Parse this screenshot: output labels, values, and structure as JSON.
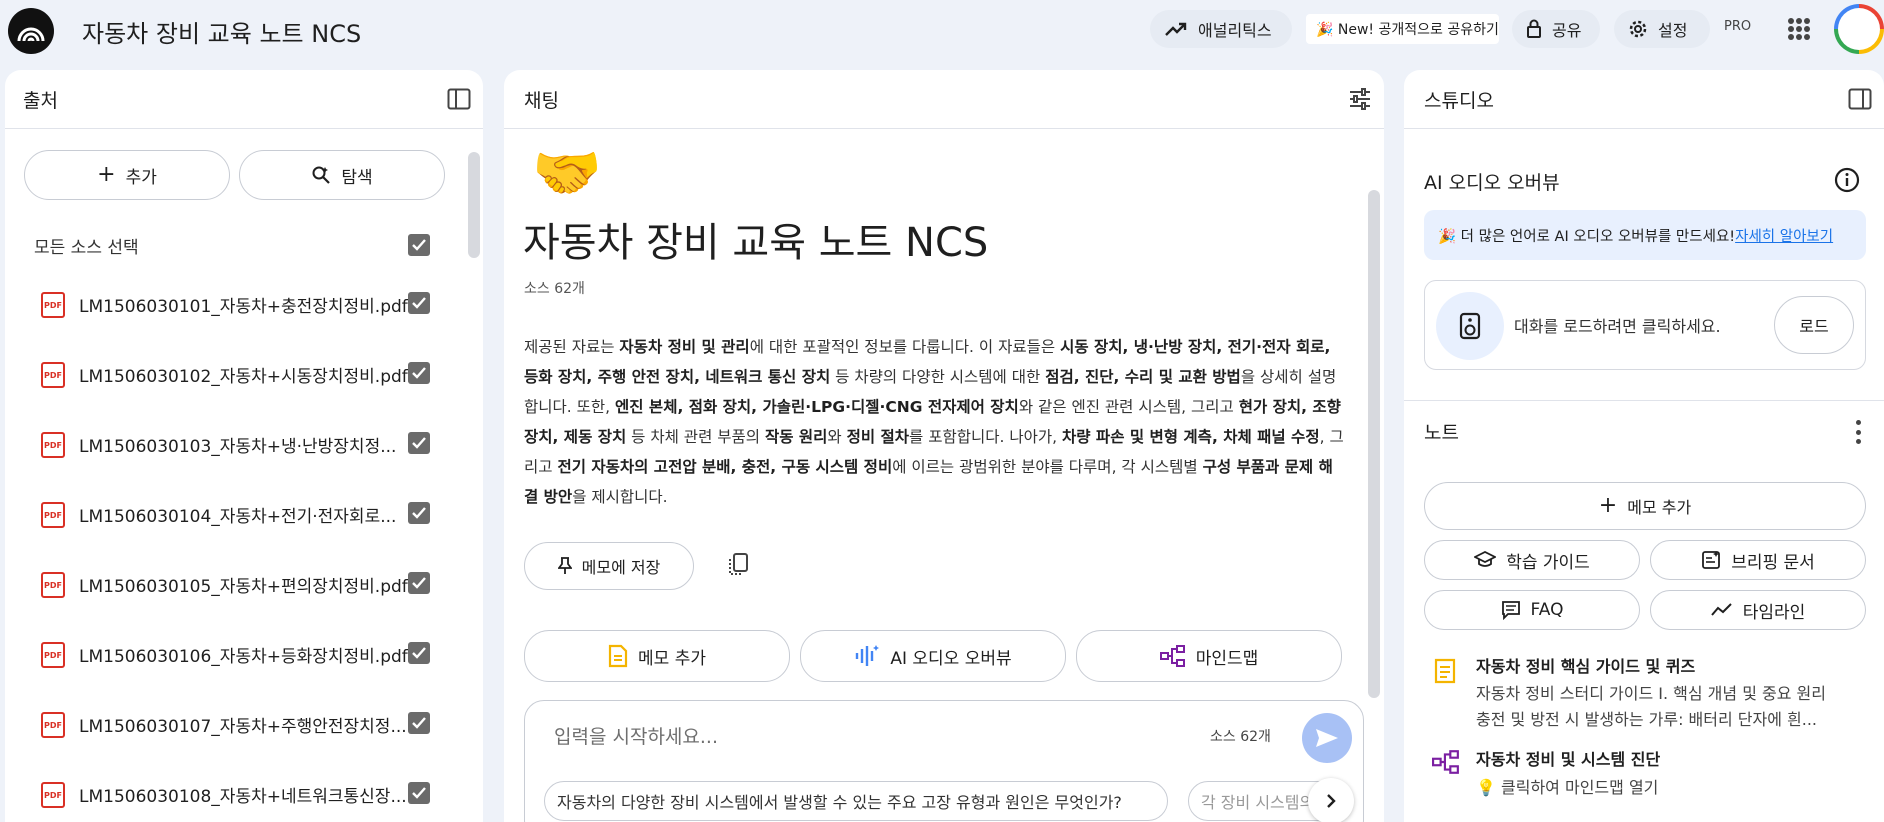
{
  "header": {
    "title": "자동차 장비 교육 노트 NCS",
    "analytics_label": "애널리틱스",
    "new_badge": "🎉 New! 공개적으로 공유하기",
    "share_label": "공유",
    "settings_label": "설정",
    "pro_label": "PRO"
  },
  "sources": {
    "title": "출처",
    "add_label": "추가",
    "explore_label": "탐색",
    "select_all_label": "모든 소스 선택",
    "pdf_icon_text": "PDF",
    "items": [
      "LM1506030101_자동차+충전장치정비.pdf",
      "LM1506030102_자동차+시동장치정비.pdf",
      "LM1506030103_자동차+냉·난방장치정...",
      "LM1506030104_자동차+전기·전자회로...",
      "LM1506030105_자동차+편의장치정비.pdf",
      "LM1506030106_자동차+등화장치정비.pdf",
      "LM1506030107_자동차+주행안전장치정...",
      "LM1506030108_자동차+네트워크통신장..."
    ]
  },
  "chat": {
    "title": "채팅",
    "emoji": "🤝",
    "notebook_title": "자동차 장비 교육 노트 NCS",
    "source_count": "소스 62개",
    "summary_html": "제공된 자료는 <b>자동차 정비 및 관리</b>에 대한 포괄적인 정보를 다룹니다. 이 자료들은 <b>시동 장치, 냉·난방 장치, 전기·전자 회로, 등화 장치, 주행 안전 장치, 네트워크 통신 장치</b> 등 차량의 다양한 시스템에 대한 <b>점검, 진단, 수리 및 교환 방법</b>을 상세히 설명합니다. 또한, <b>엔진 본체, 점화 장치, 가솔린·LPG·디젤·CNG 전자제어 장치</b>와 같은 엔진 관련 시스템, 그리고 <b>현가 장치, 조향 장치, 제동 장치</b> 등 차체 관련 부품의 <b>작동 원리</b>와 <b>정비 절차</b>를 포함합니다. 나아가, <b>차량 파손 및 변형 계측, 차체 패널 수정</b>, 그리고 <b>전기 자동차의 고전압 분배, 충전, 구동 시스템 정비</b>에 이르는 광범위한 분야를 다루며, 각 시스템별 <b>구성 부품과 문제 해결 방안</b>을 제시합니다.",
    "save_memo_label": "메모에 저장",
    "action_memo_label": "메모 추가",
    "action_audio_label": "AI 오디오 오버뷰",
    "action_mindmap_label": "마인드맵",
    "input_placeholder": "입력을 시작하세요...",
    "input_source_count": "소스 62개",
    "suggestion_1": "자동차의 다양한 장비 시스템에서 발생할 수 있는 주요 고장 유형과 원인은 무엇인가?",
    "suggestion_2": "각 장비 시스템의"
  },
  "studio": {
    "title": "스튜디오",
    "audio_overview_title": "AI 오디오 오버뷰",
    "banner_text": "🎉 더 많은 언어로 AI 오디오 오버뷰를 만드세요!",
    "banner_link": "자세히 알아보기",
    "load_prompt": "대화를 로드하려면 클릭하세요.",
    "load_label": "로드",
    "notes_title": "노트",
    "add_memo_label": "메모 추가",
    "study_guide_label": "학습 가이드",
    "briefing_label": "브리핑 문서",
    "faq_label": "FAQ",
    "timeline_label": "타임라인",
    "notes": [
      {
        "title": "자동차 정비 핵심 가이드 및 퀴즈",
        "line1": "자동차 정비 스터디 가이드 I. 핵심 개념 및 중요 원리",
        "line2": "충전 및 방전 시 발생하는 가루: 배터리 단자에 흰..."
      },
      {
        "title": "자동차 정비 및 시스템 진단",
        "line1": "💡 클릭하여 마인드맵 열기"
      }
    ]
  },
  "colors": {
    "background": "#eef2f9",
    "accent": "#4285f4",
    "send_button": "#a8c1f5",
    "pdf_red": "#d93025",
    "memo_yellow": "#f4b400",
    "mindmap_purple": "#7b1fa2"
  }
}
